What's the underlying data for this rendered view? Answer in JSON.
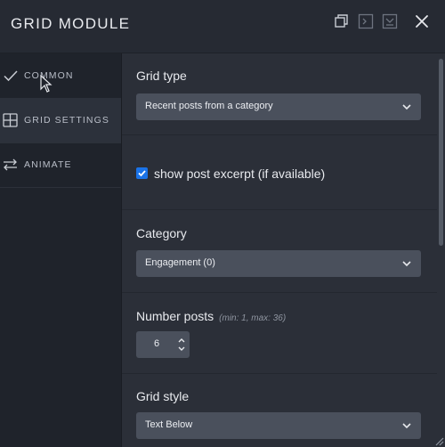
{
  "header": {
    "title": "GRID MODULE",
    "icons": [
      "duplicate-icon",
      "expand-panel-icon",
      "save-icon",
      "close-icon"
    ]
  },
  "sidebar": {
    "items": [
      {
        "label": "COMMON",
        "icon": "checkmark-icon",
        "active": false
      },
      {
        "label": "GRID SETTINGS",
        "icon": "grid-icon",
        "active": true
      },
      {
        "label": "ANIMATE",
        "icon": "swap-arrows-icon",
        "active": false
      }
    ]
  },
  "main": {
    "grid_type": {
      "label": "Grid type",
      "value": "Recent posts from a category"
    },
    "excerpt": {
      "label": "show post excerpt (if available)",
      "checked": true
    },
    "category": {
      "label": "Category",
      "value": "Engagement (0)"
    },
    "number_posts": {
      "label": "Number posts",
      "hint": "(min: 1, max: 36)",
      "value": "6"
    },
    "grid_style": {
      "label": "Grid style",
      "value": "Text Below"
    }
  },
  "colors": {
    "header_bg": "#262a33",
    "sidebar_bg": "#1f232b",
    "panel_bg": "#2b2f38",
    "field_bg": "#4a505c",
    "checkbox_accent": "#1a73e8"
  }
}
